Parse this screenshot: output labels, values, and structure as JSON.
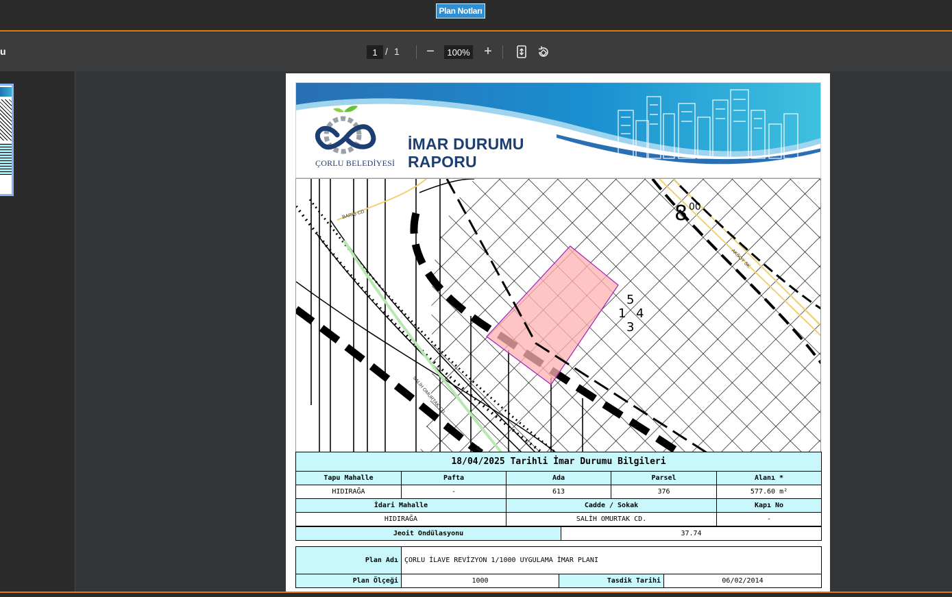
{
  "topbar": {
    "plan_notes_label": "Plan Notları"
  },
  "toolbar": {
    "title_fragment": "u",
    "current_page": "1",
    "page_separator": "/",
    "total_pages": "1",
    "zoom_out": "−",
    "zoom_level": "100%",
    "zoom_in": "+"
  },
  "report": {
    "logo_text": "ÇORLU BELEDİYESİ",
    "title_line1": "İMAR DURUMU",
    "title_line2": "RAPORU"
  },
  "map": {
    "labels": {
      "street_baris": "BARIŞ CD.",
      "street_aksoy": "AKSOY SK.",
      "street_salih": "SALİH OMURTAK CD.",
      "street_salih_partial": "SALİ",
      "elevation": "8",
      "elevation_sup": "00",
      "parcel_5": "5",
      "parcel_1": "1",
      "parcel_4": "4",
      "parcel_3": "3"
    }
  },
  "info": {
    "heading": "18/04/2025 Tarihli İmar Durumu Bilgileri",
    "headers1": [
      "Tapu Mahalle",
      "Pafta",
      "Ada",
      "Parsel",
      "Alanı *"
    ],
    "values1": [
      "HIDIRAĞA",
      "-",
      "613",
      "376",
      "577.60 m²"
    ],
    "headers2": [
      "İdari Mahalle",
      "Cadde / Sokak",
      "Kapı No"
    ],
    "values2": [
      "HIDIRAĞA",
      "SALİH OMURTAK CD.",
      "-"
    ],
    "geoid_label": "Jeoit Ondülasyonu",
    "geoid_value": "37.74"
  },
  "plan": {
    "name_label": "Plan Adı",
    "name_value": "ÇORLU İLAVE REVİZYON 1/1000 UYGULAMA İMAR PLANI",
    "scale_label": "Plan Ölçeği",
    "scale_value": "1000",
    "approval_label": "Tasdik Tarihi",
    "approval_value": "06/02/2014"
  },
  "colors": {
    "accent_orange": "#e07a10",
    "cyan_cell": "#c8f8fb",
    "parcel_fill": "#ffb8b8",
    "brand_blue": "#1d3e72"
  }
}
